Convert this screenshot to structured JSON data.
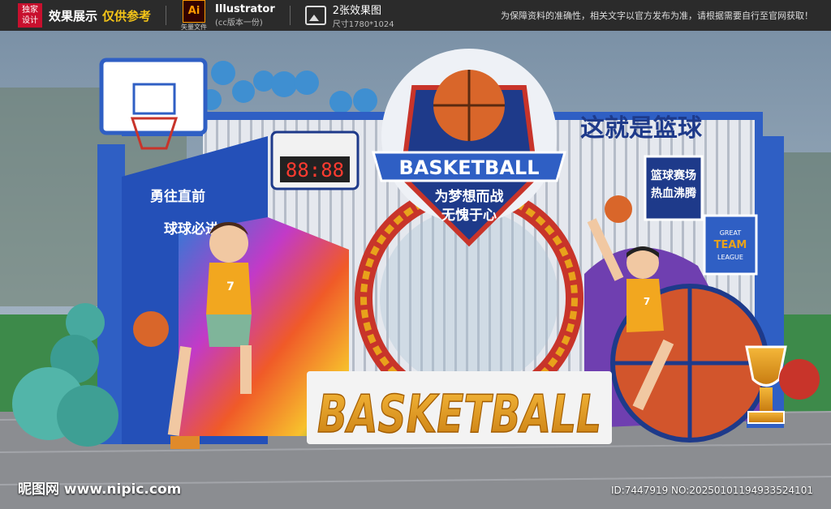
{
  "topbar": {
    "logo_line1": "独家",
    "logo_line2": "设计",
    "title": "效果展示",
    "title_highlight": "仅供参考",
    "ai_icon": "Ai",
    "ai_sub": "矢量文件",
    "software": "Illustrator",
    "software_version": "(cc版本一份)",
    "preview_count": "2张效果图",
    "preview_size": "尺寸1780*1024",
    "notice": "为保障资料的准确性，相关文字以官方发布为准，请根据需要自行至官网获取！"
  },
  "scene": {
    "header_sign": "这就是篮球",
    "scoreboard": "88:88",
    "emblem_title": "BASKETBALL",
    "emblem_line1": "为梦想而战",
    "emblem_line2": "无愧于心",
    "left_slogan1": "勇往直前",
    "left_slogan2": "球球必进",
    "right_sign_line1": "篮球赛场",
    "right_sign_line2": "热血沸腾",
    "badge_line1": "GREAT",
    "badge_line2": "TEAM",
    "badge_line3": "LEAGUE",
    "big_word": "BASKETBALL",
    "jersey_number": "7"
  },
  "footer": {
    "watermark": "昵图网 www.nipic.com",
    "image_id": "ID:7447919 NO:20250101194933524101"
  },
  "colors": {
    "frame_blue": "#2f5fc4",
    "navy": "#1e3a8a",
    "ball_orange": "#d9662a",
    "gold": "#e8a21b",
    "ring_red": "#c8342a"
  },
  "icons": [
    "basketball-icon",
    "trophy-icon",
    "image-icon",
    "ai-file-icon"
  ]
}
